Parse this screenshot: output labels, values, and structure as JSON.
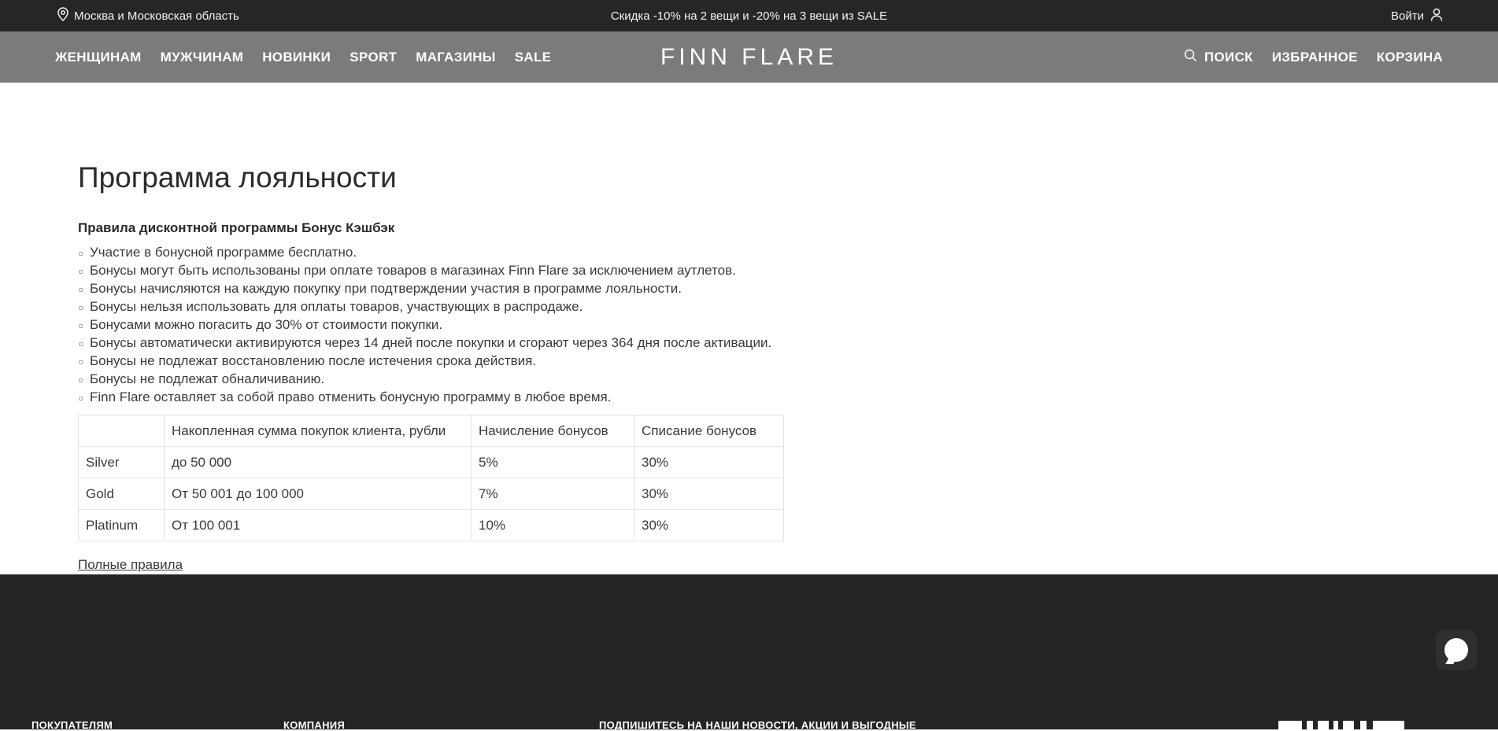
{
  "topbar": {
    "location": "Москва и Московская область",
    "promo": "Скидка -10% на 2 вещи и -20% на 3 вещи из SALE",
    "login": "Войти"
  },
  "nav": {
    "links": [
      "ЖЕНЩИНАМ",
      "МУЖЧИНАМ",
      "НОВИНКИ",
      "SPORT",
      "МАГАЗИНЫ",
      "SALE"
    ],
    "logo": "FINN FLARE",
    "search": "ПОИСК",
    "favorites": "ИЗБРАННОЕ",
    "cart": "КОРЗИНА"
  },
  "main": {
    "title": "Программа лояльности",
    "subtitle": "Правила дисконтной программы Бонус Кэшбэк",
    "rules": [
      "Участие в бонусной программе бесплатно.",
      "Бонусы могут быть использованы при оплате товаров в магазинах Finn Flare за исключением аутлетов.",
      "Бонусы начисляются на каждую покупку при подтверждении участия в программе лояльности.",
      "Бонусы нельзя использовать для оплаты товаров, участвующих в распродаже.",
      "Бонусами можно погасить до 30% от стоимости покупки.",
      "Бонусы автоматически активируются через 14 дней после покупки и сгорают через 364 дня после активации.",
      "Бонусы не подлежат восстановлению после истечения срока действия.",
      "Бонусы не подлежат обналичиванию.",
      "Finn Flare оставляет за собой право отменить бонусную программу в любое время."
    ],
    "table": {
      "headers": [
        "",
        "Накопленная сумма покупок клиента, рубли",
        "Начисление бонусов",
        "Списание бонусов"
      ],
      "rows": [
        [
          "Silver",
          "до 50 000",
          "5%",
          "30%"
        ],
        [
          "Gold",
          "От 50 001 до 100 000",
          "7%",
          "30%"
        ],
        [
          "Platinum",
          "От 100 001",
          "10%",
          "30%"
        ]
      ]
    },
    "full_rules": "Полные правила"
  },
  "footer": {
    "col1": "ПОКУПАТЕЛЯМ",
    "col2": "КОМПАНИЯ",
    "col3": "ПОДПИШИТЕСЬ НА НАШИ НОВОСТИ, АКЦИИ И ВЫГОДНЫЕ"
  },
  "icons": {
    "location": "map-pin-icon",
    "user": "user-icon",
    "search": "search-icon",
    "chat": "chat-icon",
    "qr": "qr-code-icon"
  },
  "colors": {
    "topbar": "#262626",
    "navbar": "#7b7b7b",
    "footer": "#242424",
    "text": "#2b2b2b"
  }
}
